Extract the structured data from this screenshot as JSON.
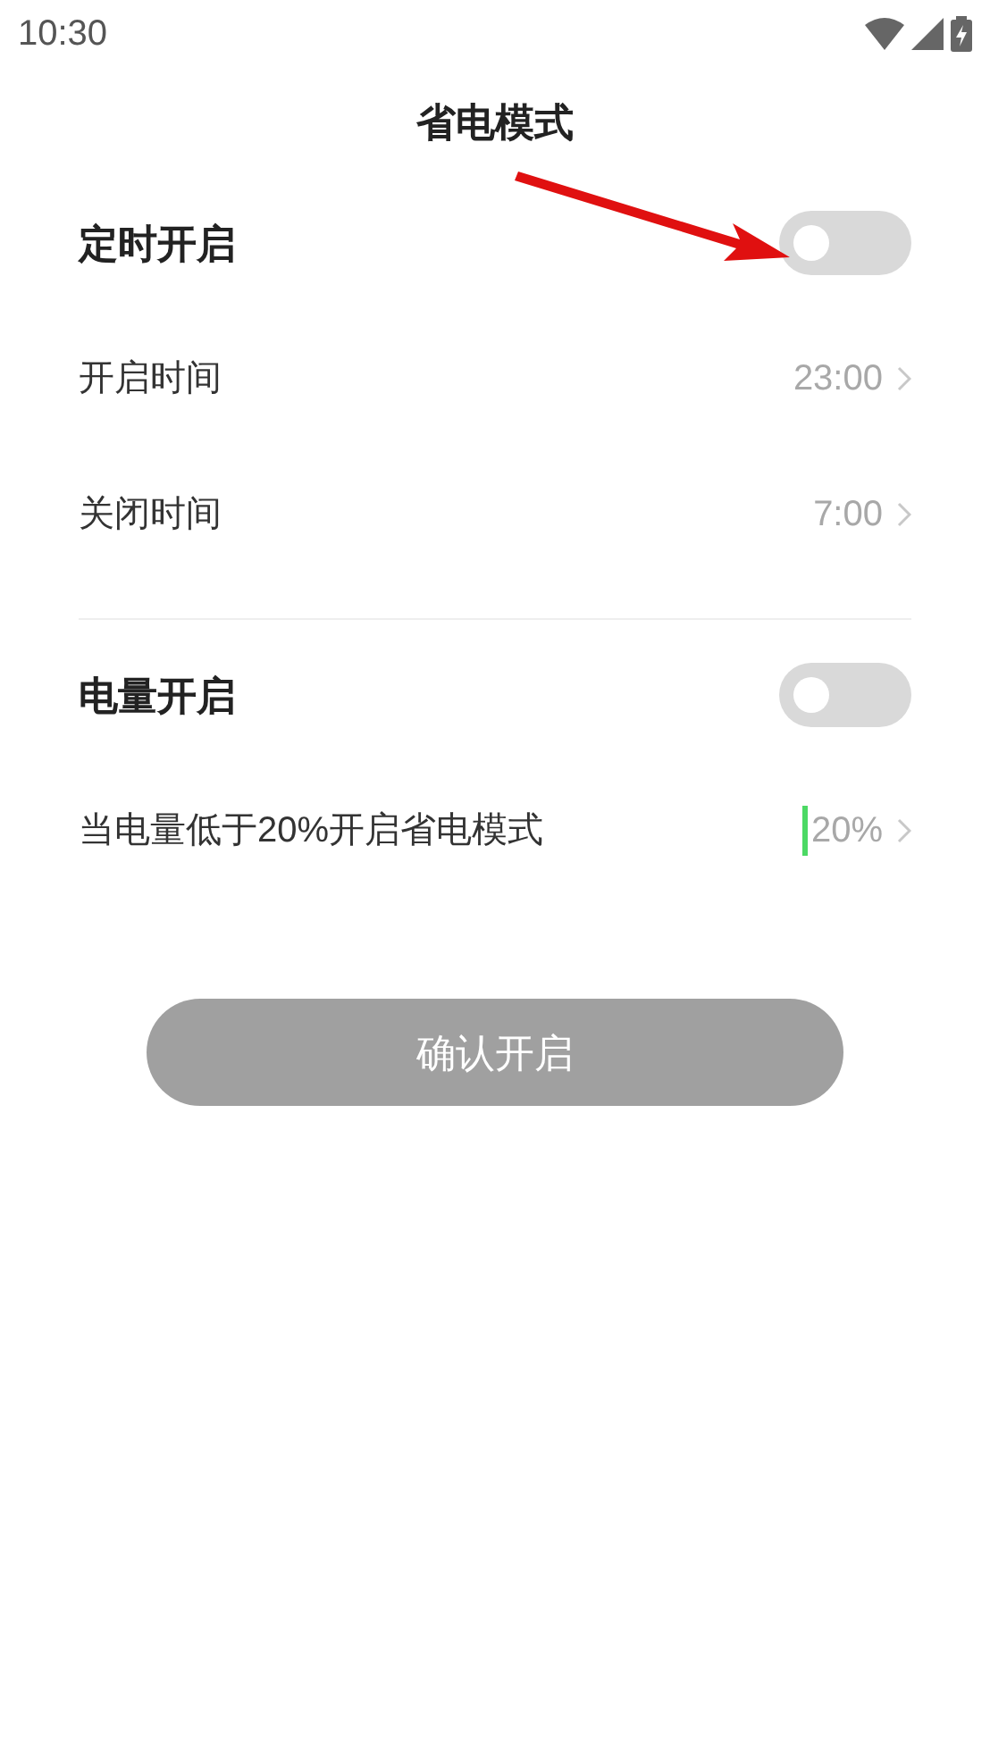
{
  "status_bar": {
    "time": "10:30"
  },
  "title": "省电模式",
  "sections": [
    {
      "title": "定时开启",
      "on": false,
      "rows": [
        {
          "kind": "picker",
          "label": "开启时间",
          "value": "23:00"
        },
        {
          "kind": "picker",
          "label": "关闭时间",
          "value": "7:00"
        }
      ]
    },
    {
      "title": "电量开启",
      "on": false,
      "rows": [
        {
          "kind": "input",
          "label": "当电量低于20%开启省电模式",
          "value": "20%",
          "focused": true
        }
      ]
    }
  ],
  "confirm_button": {
    "label": "确认开启",
    "disabled": true
  }
}
